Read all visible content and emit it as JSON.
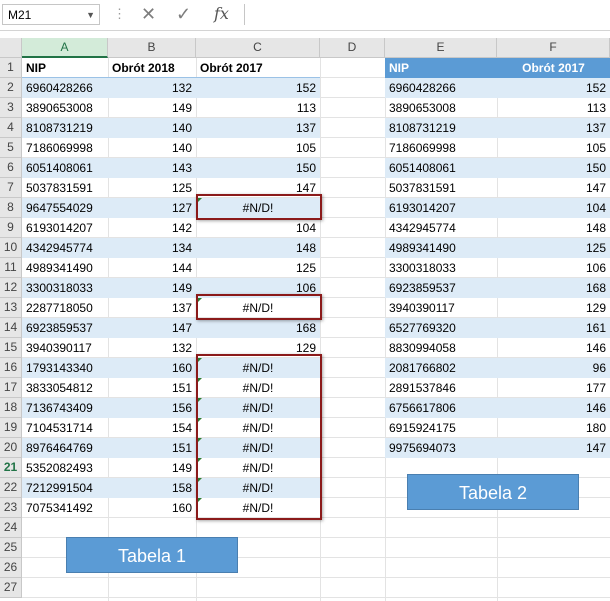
{
  "formula_bar": {
    "name_box": "M21",
    "fx_label": "fx",
    "formula": ""
  },
  "columns": [
    "A",
    "B",
    "C",
    "D",
    "E",
    "F"
  ],
  "selected_column": "A",
  "rows": [
    "1",
    "2",
    "3",
    "4",
    "5",
    "6",
    "7",
    "8",
    "9",
    "10",
    "11",
    "12",
    "13",
    "14",
    "15",
    "16",
    "17",
    "18",
    "19",
    "20",
    "21",
    "22",
    "23",
    "24",
    "25",
    "26",
    "27"
  ],
  "selected_row": "21",
  "table1": {
    "headers": [
      "NIP",
      "Obrót 2018",
      "Obrót 2017"
    ],
    "rows": [
      [
        "6960428266",
        "132",
        "152"
      ],
      [
        "3890653008",
        "149",
        "113"
      ],
      [
        "8108731219",
        "140",
        "137"
      ],
      [
        "7186069998",
        "140",
        "105"
      ],
      [
        "6051408061",
        "143",
        "150"
      ],
      [
        "5037831591",
        "125",
        "147"
      ],
      [
        "9647554029",
        "127",
        "#N/D!"
      ],
      [
        "6193014207",
        "142",
        "104"
      ],
      [
        "4342945774",
        "134",
        "148"
      ],
      [
        "4989341490",
        "144",
        "125"
      ],
      [
        "3300318033",
        "149",
        "106"
      ],
      [
        "2287718050",
        "137",
        "#N/D!"
      ],
      [
        "6923859537",
        "147",
        "168"
      ],
      [
        "3940390117",
        "132",
        "129"
      ],
      [
        "1793143340",
        "160",
        "#N/D!"
      ],
      [
        "3833054812",
        "151",
        "#N/D!"
      ],
      [
        "7136743409",
        "156",
        "#N/D!"
      ],
      [
        "7104531714",
        "154",
        "#N/D!"
      ],
      [
        "8976464769",
        "151",
        "#N/D!"
      ],
      [
        "5352082493",
        "149",
        "#N/D!"
      ],
      [
        "7212991504",
        "158",
        "#N/D!"
      ],
      [
        "7075341492",
        "160",
        "#N/D!"
      ]
    ],
    "label": "Tabela 1"
  },
  "table2": {
    "headers": [
      "NIP",
      "Obrót 2017"
    ],
    "rows": [
      [
        "6960428266",
        "152"
      ],
      [
        "3890653008",
        "113"
      ],
      [
        "8108731219",
        "137"
      ],
      [
        "7186069998",
        "105"
      ],
      [
        "6051408061",
        "150"
      ],
      [
        "5037831591",
        "147"
      ],
      [
        "6193014207",
        "104"
      ],
      [
        "4342945774",
        "148"
      ],
      [
        "4989341490",
        "125"
      ],
      [
        "3300318033",
        "106"
      ],
      [
        "6923859537",
        "168"
      ],
      [
        "3940390117",
        "129"
      ],
      [
        "6527769320",
        "161"
      ],
      [
        "8830994058",
        "146"
      ],
      [
        "2081766802",
        "96"
      ],
      [
        "2891537846",
        "177"
      ],
      [
        "6756617806",
        "146"
      ],
      [
        "6915924175",
        "180"
      ],
      [
        "9975694073",
        "147"
      ]
    ],
    "label": "Tabela 2"
  },
  "colors": {
    "band": "#ddebf7",
    "header_blue": "#5b9bd5",
    "error_box": "#8b1a1a",
    "excel_green": "#217346"
  }
}
